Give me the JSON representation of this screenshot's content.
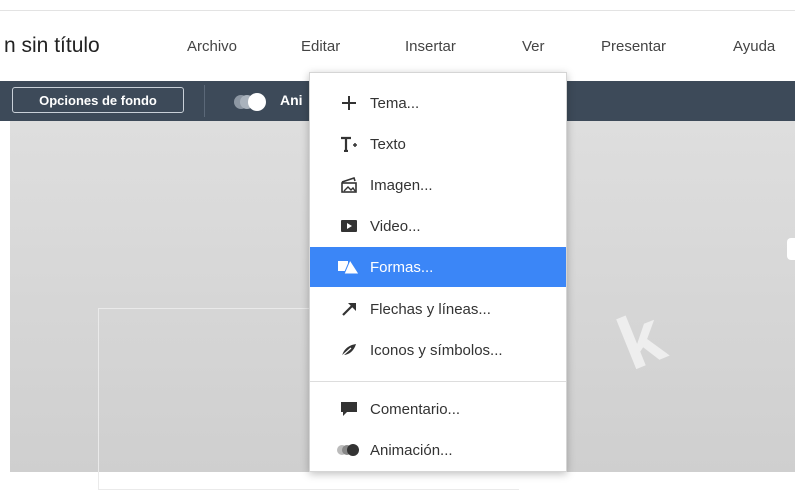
{
  "document": {
    "title": "n sin título"
  },
  "menubar": {
    "items": [
      "Archivo",
      "Editar",
      "Insertar",
      "Ver",
      "Presentar",
      "Ayuda"
    ],
    "active": "Insertar"
  },
  "toolbar": {
    "background_options_label": "Opciones de fondo",
    "animation_label": "Ani"
  },
  "insert_menu": {
    "items": [
      {
        "label": "Tema...",
        "icon": "plus-icon"
      },
      {
        "label": "Texto",
        "icon": "text-icon"
      },
      {
        "label": "Imagen...",
        "icon": "image-icon"
      },
      {
        "label": "Video...",
        "icon": "video-icon"
      },
      {
        "label": "Formas...",
        "icon": "shapes-icon",
        "selected": true
      },
      {
        "label": "Flechas y líneas...",
        "icon": "arrow-icon"
      },
      {
        "label": "Iconos y símbolos...",
        "icon": "leaf-icon"
      },
      {
        "label": "Comentario...",
        "icon": "comment-icon"
      },
      {
        "label": "Animación...",
        "icon": "animation-icon"
      }
    ]
  },
  "canvas": {
    "watermark_letter": "k"
  },
  "colors": {
    "toolbar_bg": "#3d4a59",
    "selected_item_bg": "#3b86f7",
    "canvas_bg": "#d8d8d8"
  }
}
